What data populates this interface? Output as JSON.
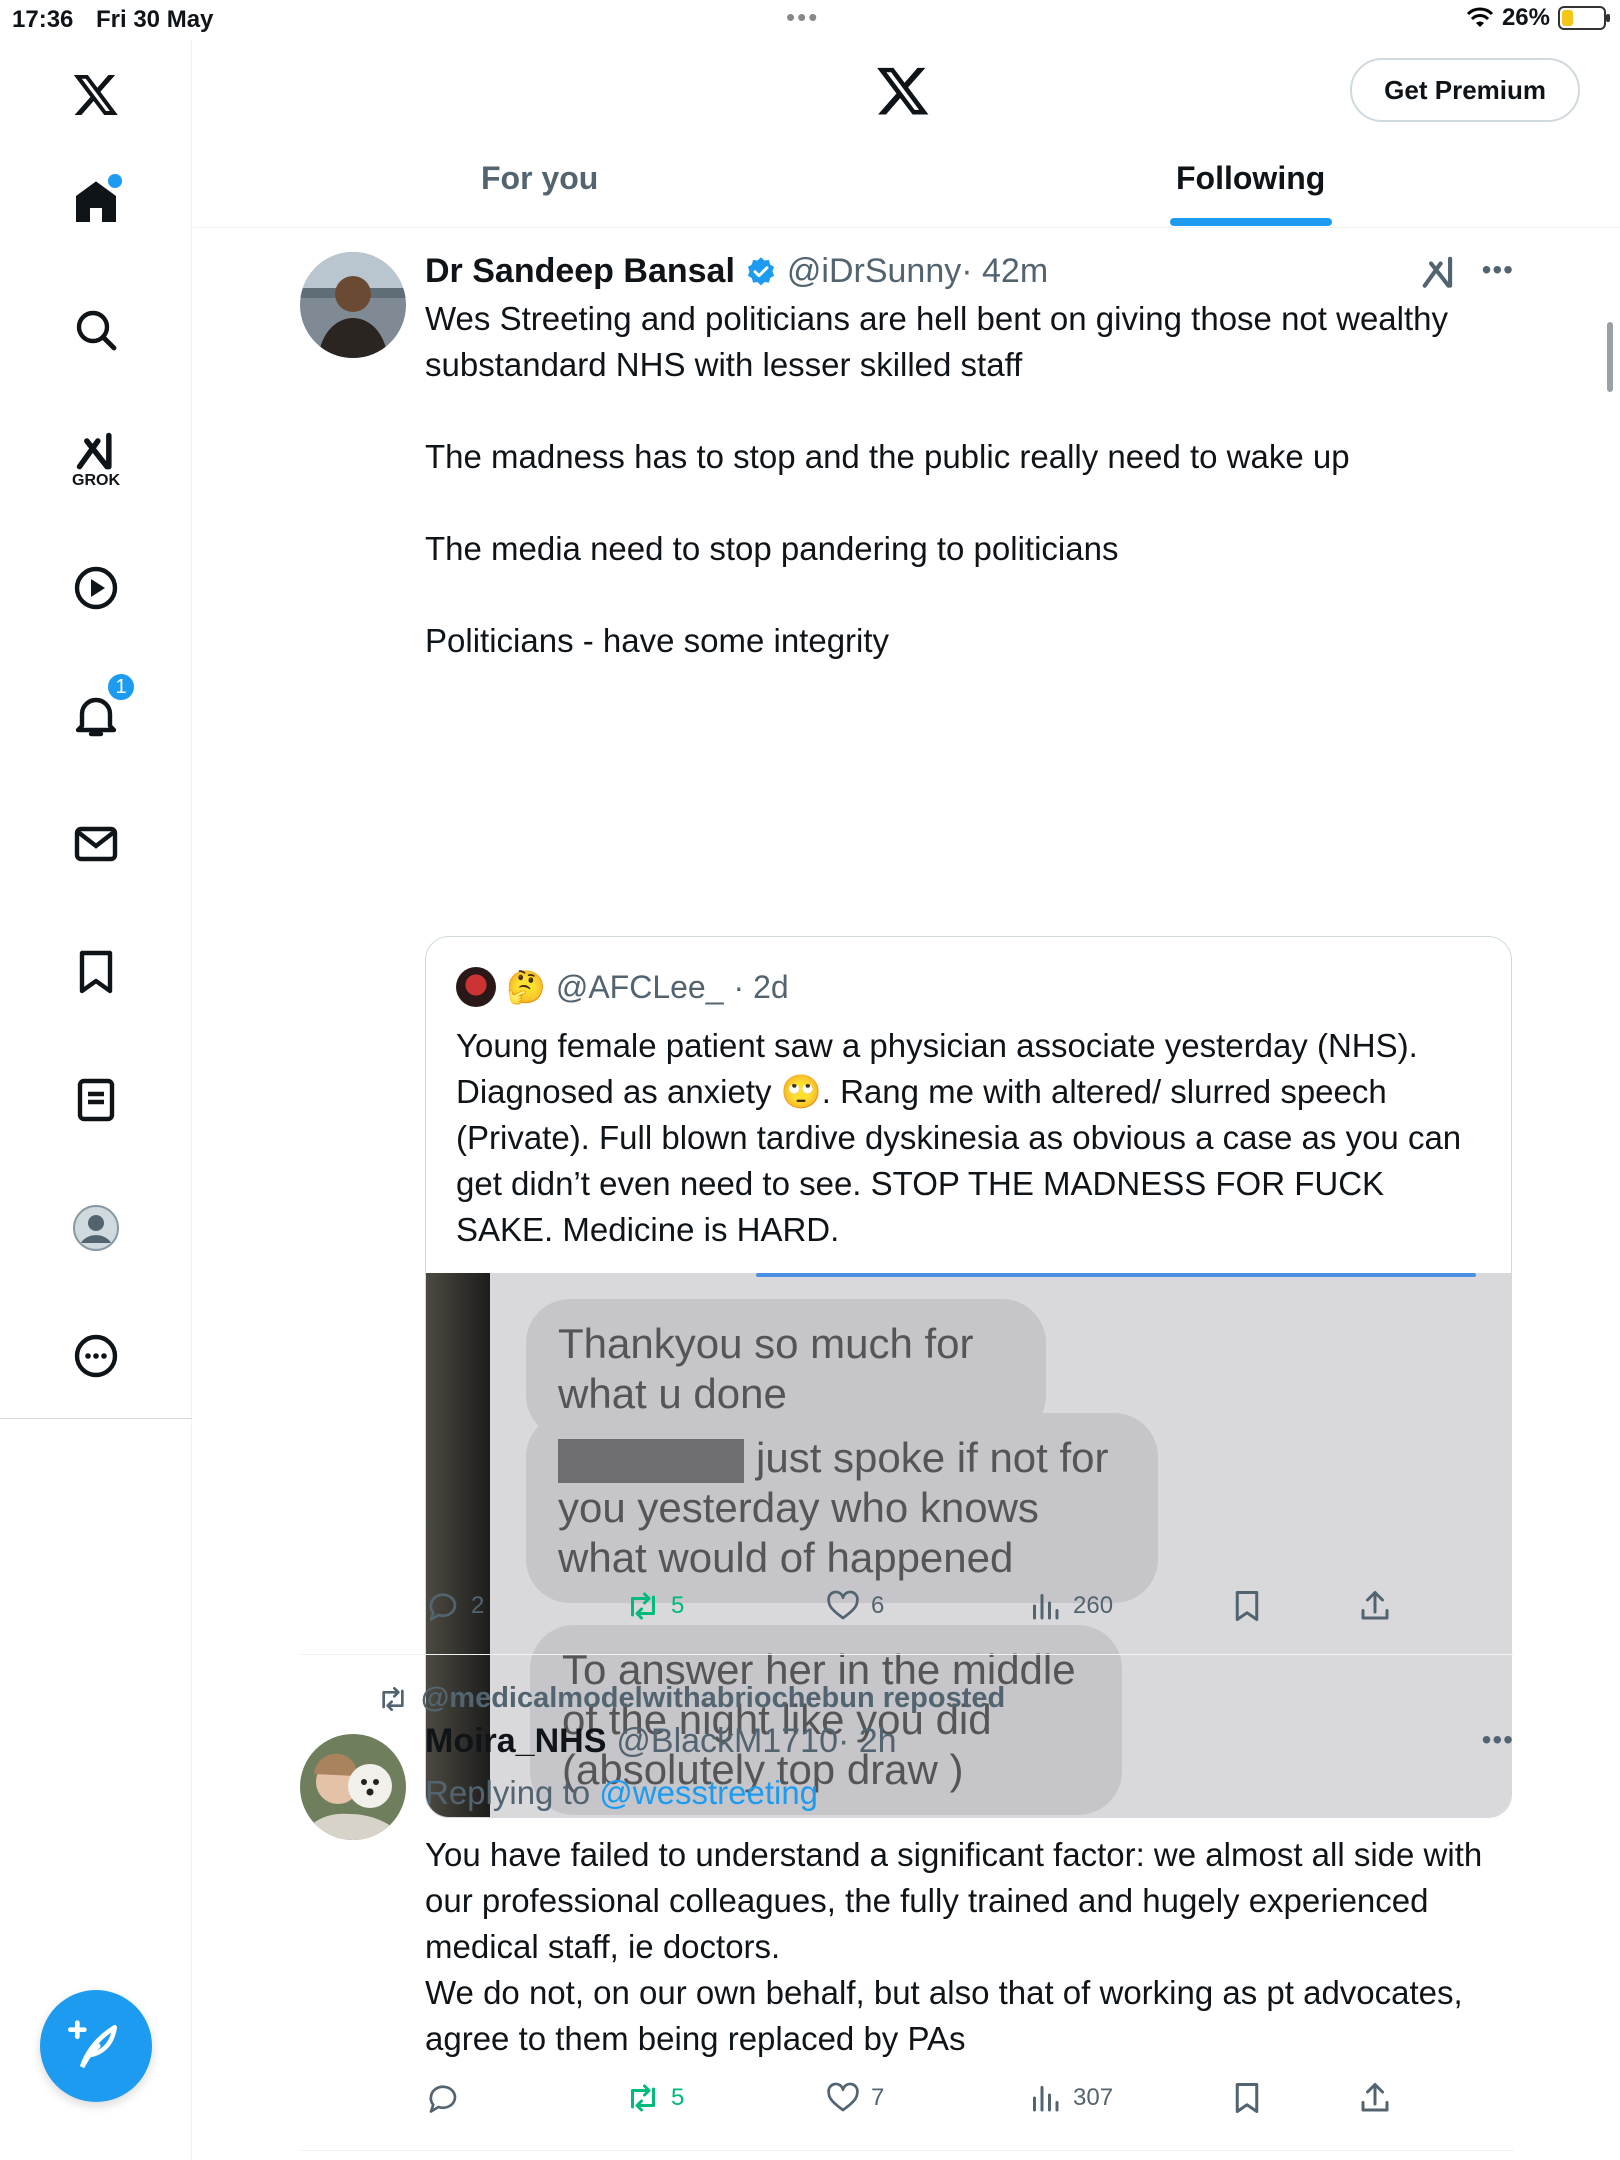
{
  "status_bar": {
    "time": "17:36",
    "date": "Fri 30 May",
    "battery": "26%",
    "battery_level": 0.26
  },
  "sidebar": {
    "items": [
      {
        "name": "home",
        "icon": "home-icon"
      },
      {
        "name": "search",
        "icon": "search-icon"
      },
      {
        "name": "grok",
        "icon": "grok-icon",
        "label": "GROK"
      },
      {
        "name": "video",
        "icon": "play-icon"
      },
      {
        "name": "notifications",
        "icon": "bell-icon",
        "badge": "1"
      },
      {
        "name": "messages",
        "icon": "mail-icon"
      },
      {
        "name": "bookmarks",
        "icon": "bookmark-icon"
      },
      {
        "name": "lists",
        "icon": "list-icon"
      },
      {
        "name": "profile",
        "icon": "profile-icon"
      },
      {
        "name": "more",
        "icon": "more-icon"
      }
    ],
    "compose_icon": "feather-plus-icon"
  },
  "header": {
    "logo": "x-logo-icon",
    "premium_button": "Get Premium",
    "tabs": [
      {
        "label": "For you"
      },
      {
        "label": "Following",
        "active": true
      }
    ]
  },
  "tweets": [
    {
      "name": "Dr Sandeep Bansal",
      "handle": "@iDrSunny",
      "time": "· 42m",
      "text": "Wes Streeting and politicians are hell bent on giving those not wealthy substandard NHS with lesser skilled staff\n\nThe madness has to stop and the public really need to wake up\n\nThe media need to stop pandering to politicians\n\nPoliticians - have some integrity",
      "quote": {
        "emoji": "🤔",
        "handle": "@AFCLee_",
        "time": "· 2d",
        "text": "Young female patient saw a physician associate yesterday (NHS). Diagnosed as anxiety 🙄. Rang me with altered/ slurred speech (Private). Full blown tardive dyskinesia as obvious a case as you can get didn’t even need to see. STOP THE MADNESS FOR FUCK SAKE. Medicine is HARD.",
        "image_messages": [
          "Thankyou so much for what u done",
          "just spoke if not for you yesterday who knows what would of happened",
          "To answer her in the middle of the night like you did (absolutely top draw )"
        ]
      },
      "stats": {
        "replies": "2",
        "reposts": "5",
        "likes": "6",
        "views": "260"
      }
    },
    {
      "repost_by": "@medicalmodelwithabriochebun reposted",
      "name": "Moira_NHS",
      "handle": "@BlackM1710",
      "time": "· 2h",
      "replying_prefix": "Replying to ",
      "replying_to": "@wesstreeting",
      "text": "You have failed to understand a significant factor: we almost all side with our professional colleagues, the fully trained and hugely experienced medical staff, ie doctors.\nWe do not, on our own behalf, but also that of working as pt advocates, agree to them being replaced by PAs",
      "stats": {
        "replies": "",
        "reposts": "5",
        "likes": "7",
        "views": "307"
      }
    }
  ],
  "colors": {
    "accent": "#1d9bf0",
    "repost_green": "#00ba7c",
    "secondary_text": "#536471"
  }
}
